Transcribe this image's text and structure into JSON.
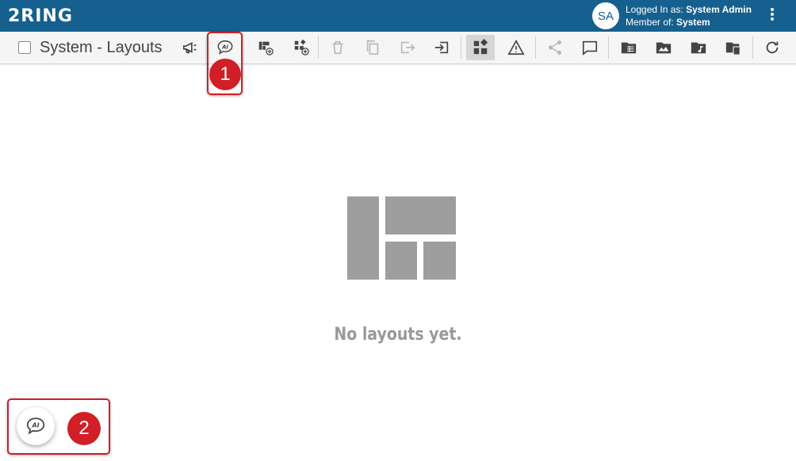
{
  "header": {
    "logo": "2RING",
    "avatar_initials": "SA",
    "logged_in_label": "Logged In as: ",
    "logged_in_value": "System Admin",
    "member_label": "Member of: ",
    "member_value": "System"
  },
  "toolbar": {
    "title": "System - Layouts",
    "buttons": [
      {
        "name": "announce-icon",
        "color": "#444444"
      },
      {
        "name": "ai-assistant-icon",
        "color": "#444444"
      },
      {
        "name": "add-layout-icon",
        "color": "#444444"
      },
      {
        "name": "add-widget-layout-icon",
        "color": "#444444"
      },
      {
        "name": "delete-icon",
        "color": "#b8b8b8"
      },
      {
        "name": "copy-icon",
        "color": "#b8b8b8"
      },
      {
        "name": "export-icon",
        "color": "#b8b8b8"
      },
      {
        "name": "import-icon",
        "color": "#444444"
      },
      {
        "name": "layouts-view-icon",
        "color": "#444444"
      },
      {
        "name": "warning-icon",
        "color": "#444444"
      },
      {
        "name": "share-icon",
        "color": "#b8b8b8"
      },
      {
        "name": "comment-icon",
        "color": "#444444"
      },
      {
        "name": "folder-table-icon",
        "color": "#444444"
      },
      {
        "name": "folder-image-icon",
        "color": "#444444"
      },
      {
        "name": "folder-music-icon",
        "color": "#444444"
      },
      {
        "name": "folder-copy-icon",
        "color": "#444444"
      },
      {
        "name": "refresh-icon",
        "color": "#444444"
      }
    ]
  },
  "main": {
    "empty_message": "No layouts yet."
  },
  "callouts": [
    {
      "number": "1"
    },
    {
      "number": "2"
    }
  ],
  "colors": {
    "brand": "#15608e",
    "callout": "#d01f26",
    "empty_art": "#9e9e9e"
  }
}
